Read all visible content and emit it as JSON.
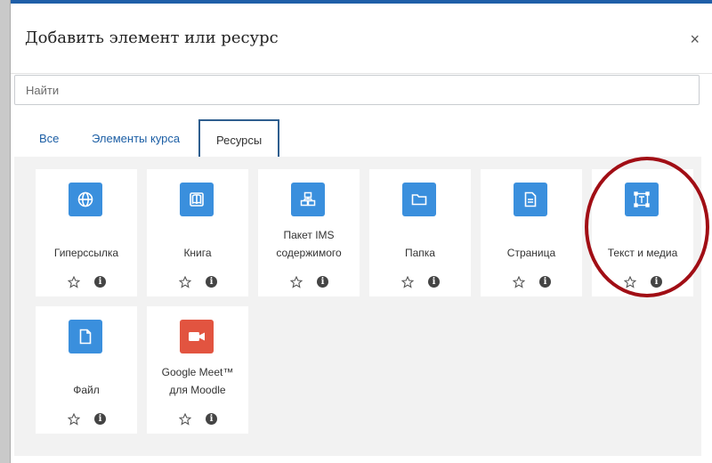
{
  "dialog": {
    "title": "Добавить элемент или ресурс",
    "close_glyph": "×"
  },
  "search": {
    "placeholder": "Найти",
    "value": ""
  },
  "tabs": [
    {
      "label": "Все",
      "active": false
    },
    {
      "label": "Элементы курса",
      "active": false
    },
    {
      "label": "Ресурсы",
      "active": true
    }
  ],
  "tiles": [
    {
      "label_lines": [
        "Гиперссылка"
      ],
      "icon": "globe-icon",
      "icon_color": "#3a8fdd"
    },
    {
      "label_lines": [
        "Книга"
      ],
      "icon": "book-icon",
      "icon_color": "#3a8fdd"
    },
    {
      "label_lines": [
        "Пакет IMS",
        "содержимого"
      ],
      "icon": "package-icon",
      "icon_color": "#3a8fdd"
    },
    {
      "label_lines": [
        "Папка"
      ],
      "icon": "folder-icon",
      "icon_color": "#3a8fdd"
    },
    {
      "label_lines": [
        "Страница"
      ],
      "icon": "page-icon",
      "icon_color": "#3a8fdd"
    },
    {
      "label_lines": [
        "Текст и медиа"
      ],
      "icon": "text-media-icon",
      "icon_color": "#3a8fdd"
    },
    {
      "label_lines": [
        "Файл"
      ],
      "icon": "file-icon",
      "icon_color": "#3a8fdd"
    },
    {
      "label_lines": [
        "Google Meet™",
        "для Moodle"
      ],
      "icon": "video-camera-icon",
      "icon_color": "#e25440"
    }
  ],
  "tile_actions": {
    "star_icon": "star-outline-icon",
    "info_icon": "info-icon",
    "info_glyph": "i"
  },
  "annotation": {
    "highlight_color": "#a10e15"
  }
}
